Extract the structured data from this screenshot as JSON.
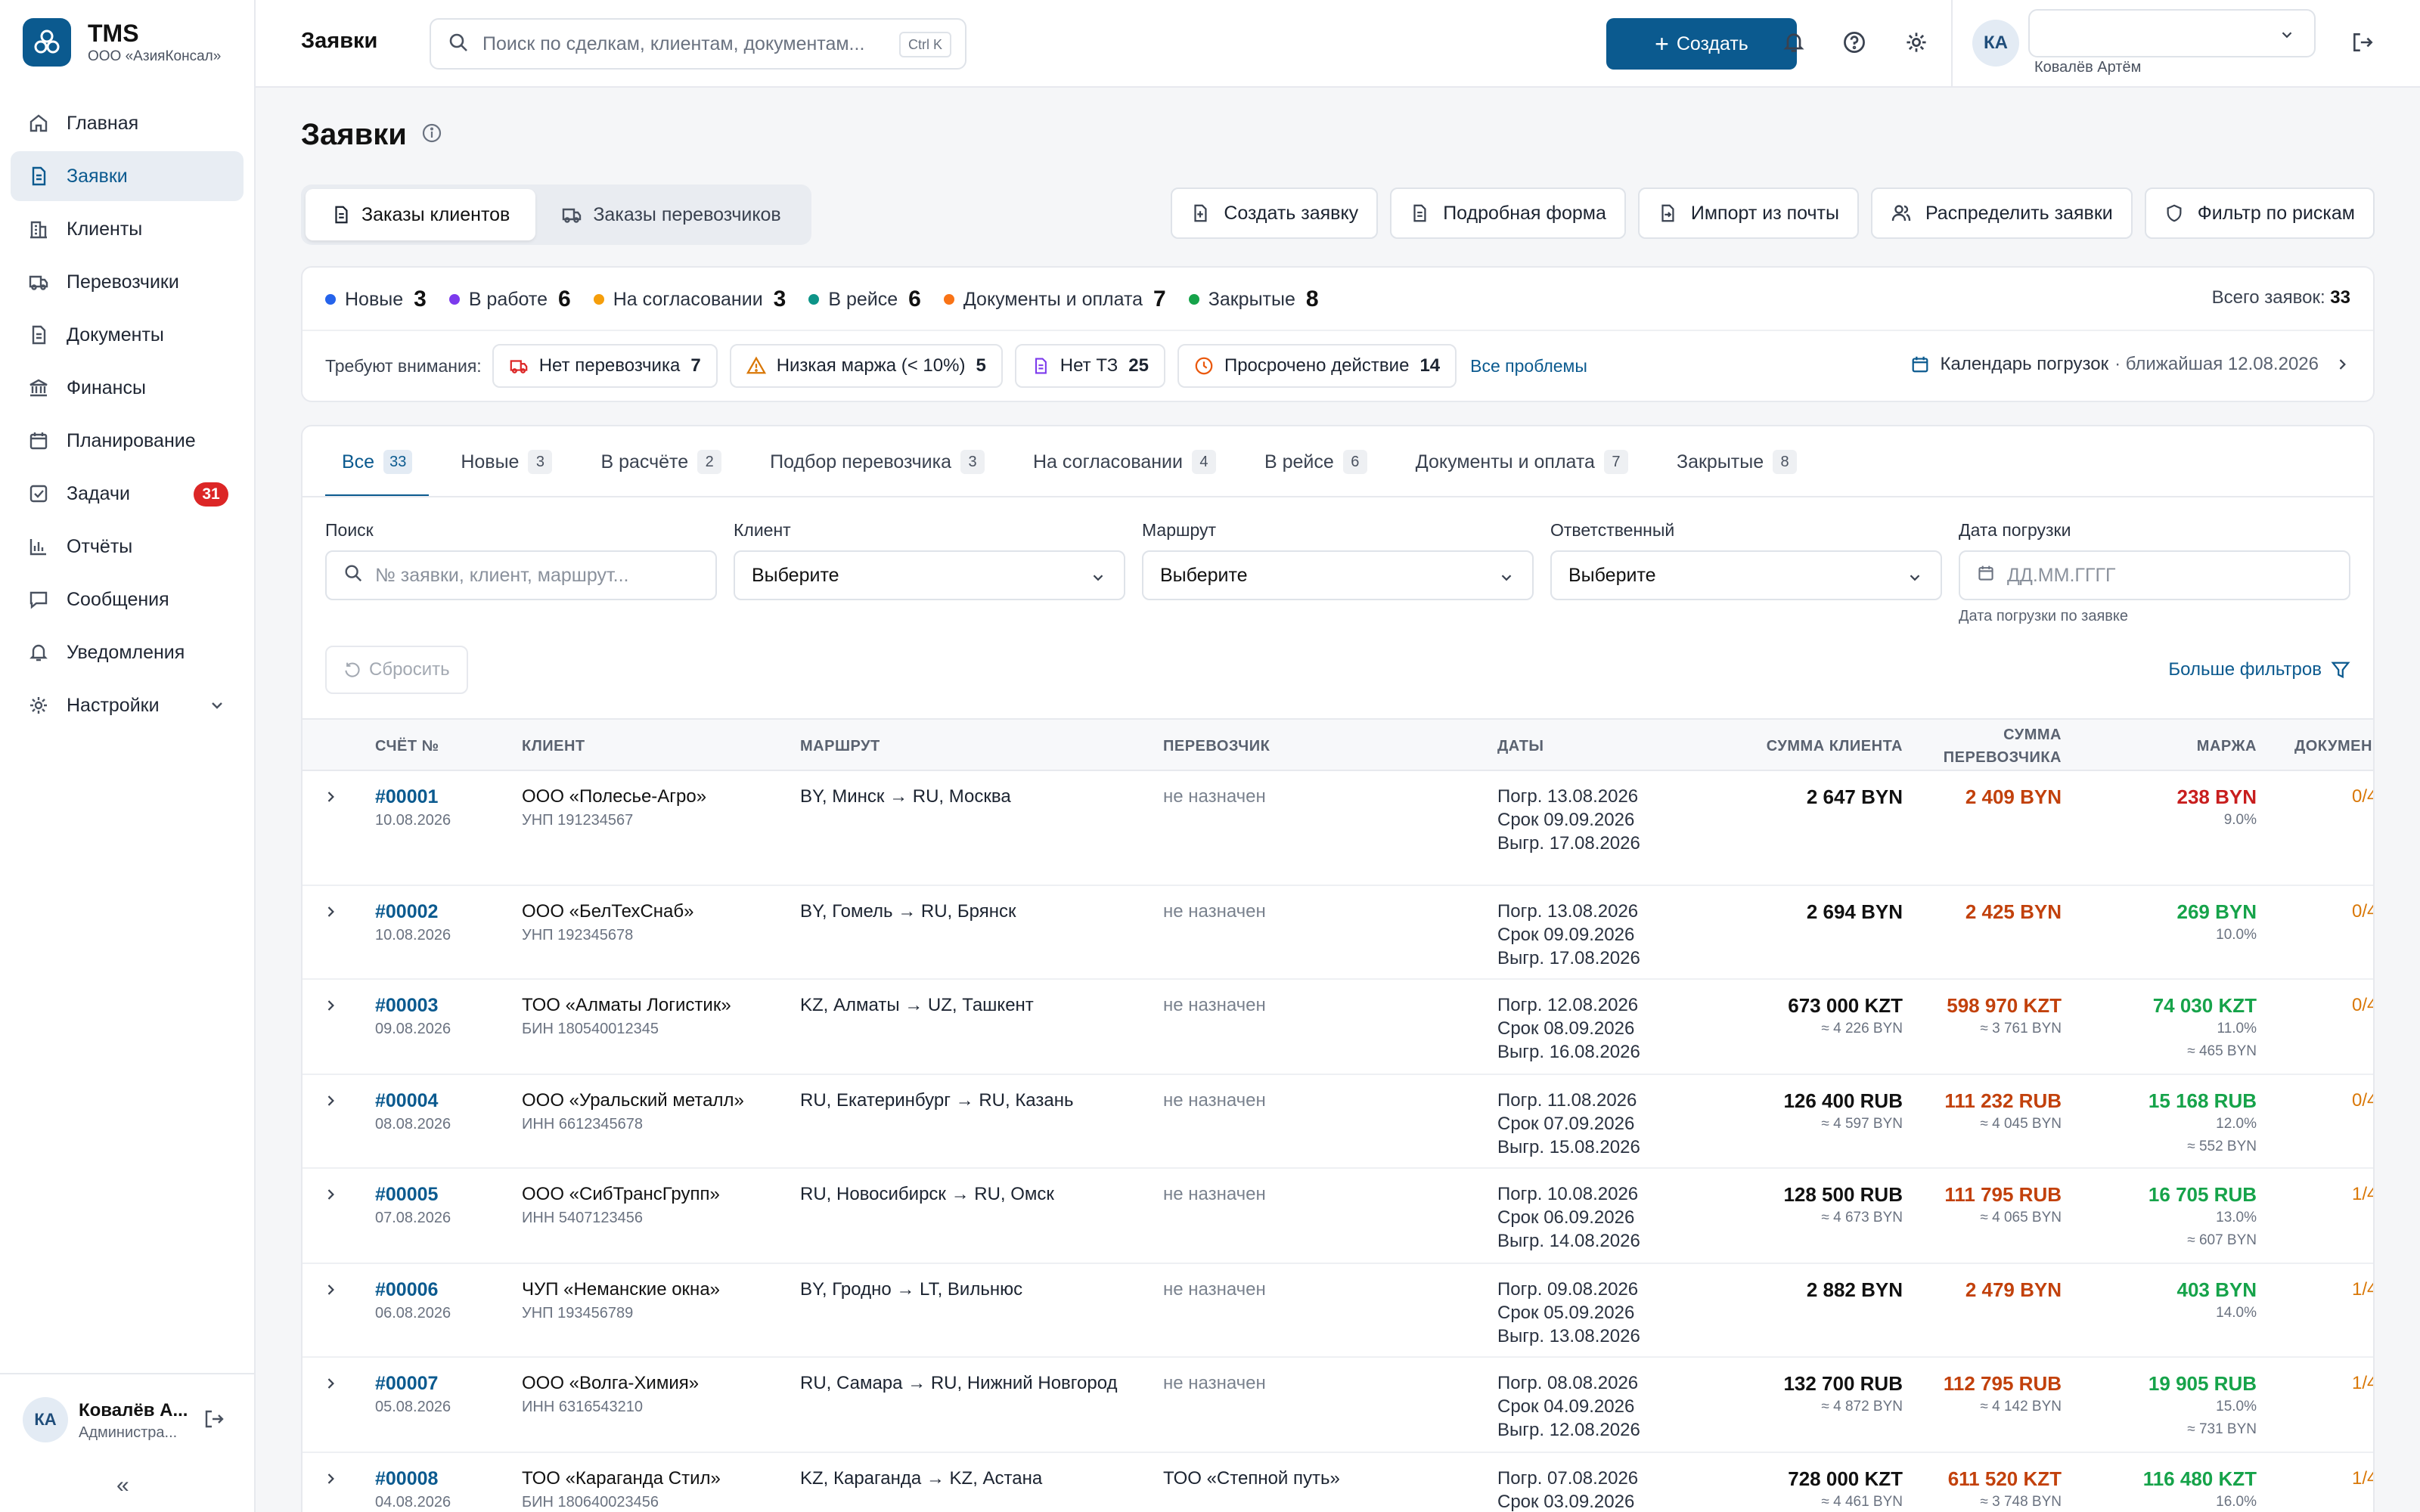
{
  "brand": {
    "name": "TMS",
    "org": "ООО «АзияКонсал»"
  },
  "sidebar": {
    "items": [
      {
        "label": "Главная",
        "icon": "home-icon"
      },
      {
        "label": "Заявки",
        "icon": "document-icon",
        "active": true
      },
      {
        "label": "Клиенты",
        "icon": "building-icon"
      },
      {
        "label": "Перевозчики",
        "icon": "truck-icon"
      },
      {
        "label": "Документы",
        "icon": "file-icon"
      },
      {
        "label": "Финансы",
        "icon": "bank-icon"
      },
      {
        "label": "Планирование",
        "icon": "calendar-icon"
      },
      {
        "label": "Задачи",
        "icon": "checkbox-icon",
        "badge": "31"
      },
      {
        "label": "Отчёты",
        "icon": "bar-chart-icon"
      },
      {
        "label": "Сообщения",
        "icon": "chat-icon"
      },
      {
        "label": "Уведомления",
        "icon": "bell-icon"
      },
      {
        "label": "Настройки",
        "icon": "gear-icon"
      }
    ],
    "user": {
      "initials": "КА",
      "name": "Ковалёв А...",
      "role": "Администра..."
    }
  },
  "header": {
    "title": "Заявки",
    "search_placeholder": "Поиск по сделкам, клиентам, документам...",
    "search_shortcut": "Ctrl K",
    "create_label": "Создать",
    "avatar_initials": "КА",
    "user_name": "Ковалёв Артём"
  },
  "page": {
    "title": "Заявки",
    "segments": [
      "Заказы клиентов",
      "Заказы перевозчиков"
    ],
    "actions": [
      "Создать заявку",
      "Подробная форма",
      "Импорт из почты",
      "Распределить заявки",
      "Фильтр по рискам"
    ]
  },
  "stats": {
    "items": [
      {
        "label": "Новые",
        "count": "3",
        "color": "#2563eb"
      },
      {
        "label": "В работе",
        "count": "6",
        "color": "#7c3aed"
      },
      {
        "label": "На согласовании",
        "count": "3",
        "color": "#f59e0b"
      },
      {
        "label": "В рейсе",
        "count": "6",
        "color": "#0d9488"
      },
      {
        "label": "Документы и оплата",
        "count": "7",
        "color": "#f97316"
      },
      {
        "label": "Закрытые",
        "count": "8",
        "color": "#16a34a"
      }
    ],
    "total_label": "Всего заявок:",
    "total_value": "33",
    "attention_label": "Требуют внимания:",
    "chips": [
      {
        "label": "Нет перевозчика",
        "count": "7",
        "icon": "truck-icon"
      },
      {
        "label": "Низкая маржа (< 10%)",
        "count": "5",
        "icon": "warning-icon"
      },
      {
        "label": "Нет ТЗ",
        "count": "25",
        "icon": "file-icon"
      },
      {
        "label": "Просрочено действие",
        "count": "14",
        "icon": "clock-icon"
      }
    ],
    "all_problems": "Все проблемы",
    "calendar_label": "Календарь погрузок",
    "calendar_nearest": "· ближайшая 12.08.2026"
  },
  "tabs": [
    {
      "label": "Все",
      "count": "33"
    },
    {
      "label": "Новые",
      "count": "3"
    },
    {
      "label": "В расчёте",
      "count": "2"
    },
    {
      "label": "Подбор перевозчика",
      "count": "3"
    },
    {
      "label": "На согласовании",
      "count": "4"
    },
    {
      "label": "В рейсе",
      "count": "6"
    },
    {
      "label": "Документы и оплата",
      "count": "7"
    },
    {
      "label": "Закрытые",
      "count": "8"
    }
  ],
  "filters": {
    "search_label": "Поиск",
    "search_placeholder": "№ заявки, клиент, маршрут...",
    "client_label": "Клиент",
    "client_value": "Выберите",
    "route_label": "Маршрут",
    "route_value": "Выберите",
    "owner_label": "Ответственный",
    "owner_value": "Выберите",
    "date_label": "Дата погрузки",
    "date_placeholder": "ДД.ММ.ГГГГ",
    "date_hint": "Дата погрузки по заявке",
    "reset_label": "Сбросить",
    "more_label": "Больше фильтров"
  },
  "table": {
    "columns": {
      "id": "СЧЁТ №",
      "client": "КЛИЕНТ",
      "route": "МАРШРУТ",
      "carrier": "ПЕРЕВОЗЧИК",
      "dates": "ДАТЫ",
      "sum_client": "СУММА КЛИЕНТА",
      "sum_carrier_1": "СУММА",
      "sum_carrier_2": "ПЕРЕВОЗЧИКА",
      "margin": "МАРЖА",
      "docs": "ДОКУМЕН"
    },
    "rows": [
      {
        "id": "#00001",
        "date": "10.08.2026",
        "client": "ООО «Полесье-Агро»",
        "reg": "УНП 191234567",
        "route": "BY, Минск → RU, Москва",
        "carrier": "не назначен",
        "load": "Погр. 13.08.2026",
        "due": "Срок 09.09.2026",
        "unload": "Выгр. 17.08.2026",
        "sum_client": "2 647 BYN",
        "sum_client_conv": "",
        "sum_carrier": "2 409 BYN",
        "sum_carrier_conv": "",
        "margin": "238 BYN",
        "margin_pct": "9.0%",
        "margin_conv": "",
        "margin_low": true,
        "docs": "0/4"
      },
      {
        "id": "#00002",
        "date": "10.08.2026",
        "client": "ООО «БелТехСнаб»",
        "reg": "УНП 192345678",
        "route": "BY, Гомель → RU, Брянск",
        "carrier": "не назначен",
        "load": "Погр. 13.08.2026",
        "due": "Срок 09.09.2026",
        "unload": "Выгр. 17.08.2026",
        "sum_client": "2 694 BYN",
        "sum_client_conv": "",
        "sum_carrier": "2 425 BYN",
        "sum_carrier_conv": "",
        "margin": "269 BYN",
        "margin_pct": "10.0%",
        "margin_conv": "",
        "margin_low": false,
        "docs": "0/4"
      },
      {
        "id": "#00003",
        "date": "09.08.2026",
        "client": "ТОО «Алматы Логистик»",
        "reg": "БИН 180540012345",
        "route": "KZ, Алматы → UZ, Ташкент",
        "carrier": "не назначен",
        "load": "Погр. 12.08.2026",
        "due": "Срок 08.09.2026",
        "unload": "Выгр. 16.08.2026",
        "sum_client": "673 000 KZT",
        "sum_client_conv": "≈ 4 226 BYN",
        "sum_carrier": "598 970 KZT",
        "sum_carrier_conv": "≈ 3 761 BYN",
        "margin": "74 030 KZT",
        "margin_pct": "11.0%",
        "margin_conv": "≈ 465 BYN",
        "margin_low": false,
        "docs": "0/4"
      },
      {
        "id": "#00004",
        "date": "08.08.2026",
        "client": "ООО «Уральский металл»",
        "reg": "ИНН 6612345678",
        "route": "RU, Екатеринбург → RU, Казань",
        "carrier": "не назначен",
        "load": "Погр. 11.08.2026",
        "due": "Срок 07.09.2026",
        "unload": "Выгр. 15.08.2026",
        "sum_client": "126 400 RUB",
        "sum_client_conv": "≈ 4 597 BYN",
        "sum_carrier": "111 232 RUB",
        "sum_carrier_conv": "≈ 4 045 BYN",
        "margin": "15 168 RUB",
        "margin_pct": "12.0%",
        "margin_conv": "≈ 552 BYN",
        "margin_low": false,
        "docs": "0/4"
      },
      {
        "id": "#00005",
        "date": "07.08.2026",
        "client": "ООО «СибТрансГрупп»",
        "reg": "ИНН 5407123456",
        "route": "RU, Новосибирск → RU, Омск",
        "carrier": "не назначен",
        "load": "Погр. 10.08.2026",
        "due": "Срок 06.09.2026",
        "unload": "Выгр. 14.08.2026",
        "sum_client": "128 500 RUB",
        "sum_client_conv": "≈ 4 673 BYN",
        "sum_carrier": "111 795 RUB",
        "sum_carrier_conv": "≈ 4 065 BYN",
        "margin": "16 705 RUB",
        "margin_pct": "13.0%",
        "margin_conv": "≈ 607 BYN",
        "margin_low": false,
        "docs": "1/4"
      },
      {
        "id": "#00006",
        "date": "06.08.2026",
        "client": "ЧУП «Неманские окна»",
        "reg": "УНП 193456789",
        "route": "BY, Гродно → LT, Вильнюс",
        "carrier": "не назначен",
        "load": "Погр. 09.08.2026",
        "due": "Срок 05.09.2026",
        "unload": "Выгр. 13.08.2026",
        "sum_client": "2 882 BYN",
        "sum_client_conv": "",
        "sum_carrier": "2 479 BYN",
        "sum_carrier_conv": "",
        "margin": "403 BYN",
        "margin_pct": "14.0%",
        "margin_conv": "",
        "margin_low": false,
        "docs": "1/4"
      },
      {
        "id": "#00007",
        "date": "05.08.2026",
        "client": "ООО «Волга-Химия»",
        "reg": "ИНН 6316543210",
        "route": "RU, Самара → RU, Нижний Новгород",
        "carrier": "не назначен",
        "load": "Погр. 08.08.2026",
        "due": "Срок 04.09.2026",
        "unload": "Выгр. 12.08.2026",
        "sum_client": "132 700 RUB",
        "sum_client_conv": "≈ 4 872 BYN",
        "sum_carrier": "112 795 RUB",
        "sum_carrier_conv": "≈ 4 142 BYN",
        "margin": "19 905 RUB",
        "margin_pct": "15.0%",
        "margin_conv": "≈ 731 BYN",
        "margin_low": false,
        "docs": "1/4"
      },
      {
        "id": "#00008",
        "date": "04.08.2026",
        "client": "ТОО «Караганда Стил»",
        "reg": "БИН 180640023456",
        "route": "KZ, Караганда → KZ, Астана",
        "carrier": "ТОО «Степной путь»",
        "load": "Погр. 07.08.2026",
        "due": "Срок 03.09.2026",
        "unload": "",
        "sum_client": "728 000 KZT",
        "sum_client_conv": "≈ 4 461 BYN",
        "sum_carrier": "611 520 KZT",
        "sum_carrier_conv": "≈ 3 748 BYN",
        "margin": "116 480 KZT",
        "margin_pct": "16.0%",
        "margin_conv": "",
        "margin_low": false,
        "docs": "1/4"
      }
    ]
  }
}
